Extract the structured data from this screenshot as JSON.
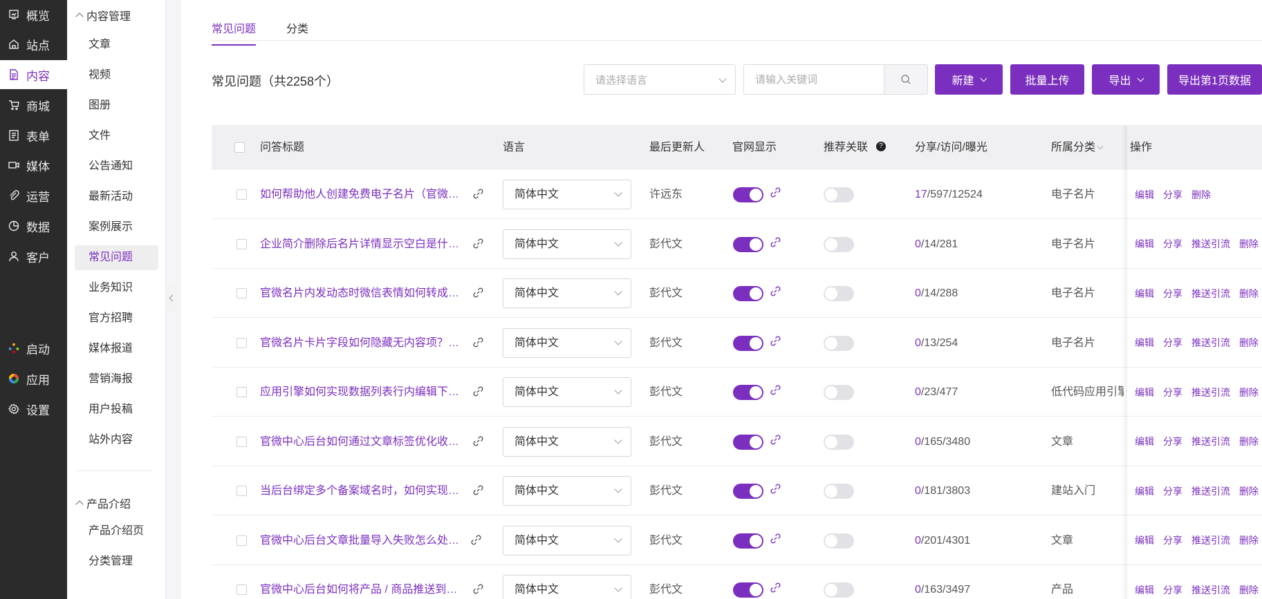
{
  "colors": {
    "accent": "#7b2fbe",
    "nav_bg": "#2b2b2b"
  },
  "nav": {
    "items": [
      {
        "label": "概览",
        "icon": "overview-icon"
      },
      {
        "label": "站点",
        "icon": "home-icon"
      },
      {
        "label": "内容",
        "icon": "document-icon",
        "active": true
      },
      {
        "label": "商城",
        "icon": "cart-icon"
      },
      {
        "label": "表单",
        "icon": "form-icon"
      },
      {
        "label": "媒体",
        "icon": "video-icon"
      },
      {
        "label": "运营",
        "icon": "paperclip-icon"
      },
      {
        "label": "数据",
        "icon": "pie-chart-icon"
      },
      {
        "label": "客户",
        "icon": "user-icon"
      }
    ],
    "bottom": [
      {
        "label": "启动",
        "icon": "launch-dots-icon"
      },
      {
        "label": "应用",
        "icon": "apps-icon"
      },
      {
        "label": "设置",
        "icon": "gear-icon"
      }
    ]
  },
  "subnav": {
    "group1": "内容管理",
    "items": [
      "文章",
      "视频",
      "图册",
      "文件",
      "公告通知",
      "最新活动",
      "案例展示",
      "常见问题",
      "业务知识",
      "官方招聘",
      "媒体报道",
      "营销海报",
      "用户投稿",
      "站外内容"
    ],
    "active_index": 7,
    "group2": "产品介绍",
    "items2": [
      "产品介绍页",
      "分类管理"
    ]
  },
  "tabs": [
    "常见问题",
    "分类"
  ],
  "list_title": "常见问题（共2258个）",
  "filters": {
    "lang_placeholder": "请选择语言",
    "keyword_placeholder": "请输入关键词"
  },
  "buttons": {
    "new": "新建",
    "batch_upload": "批量上传",
    "export": "导出",
    "export_page": "导出第1页数据"
  },
  "table": {
    "headers": [
      "问答标题",
      "语言",
      "最后更新人",
      "官网显示",
      "推荐关联",
      "分享/访问/曝光",
      "所属分类",
      "操作"
    ],
    "rows": [
      {
        "title": "如何帮助他人创建免费电子名片（官微名...",
        "lang": "简体中文",
        "updater": "许远东",
        "site_show": true,
        "recommend": false,
        "share": "17",
        "stats_rest": "/597/12524",
        "category": "电子名片",
        "ops": [
          "编辑",
          "分享",
          "删除"
        ]
      },
      {
        "title": "企业简介删除后名片详情显示空白是什么...",
        "lang": "简体中文",
        "updater": "彭代文",
        "site_show": true,
        "recommend": false,
        "share": "0",
        "stats_rest": "/14/281",
        "category": "电子名片",
        "ops": [
          "编辑",
          "分享",
          "推送引流",
          "删除"
        ]
      },
      {
        "title": "官微名片内发动态时微信表情如何转成通...",
        "lang": "简体中文",
        "updater": "彭代文",
        "site_show": true,
        "recommend": false,
        "share": "0",
        "stats_rest": "/14/288",
        "category": "电子名片",
        "ops": [
          "编辑",
          "分享",
          "推送引流",
          "删除"
        ]
      },
      {
        "title": "官微名片卡片字段如何隐藏无内容项？（...",
        "lang": "简体中文",
        "updater": "彭代文",
        "site_show": true,
        "recommend": false,
        "share": "0",
        "stats_rest": "/13/254",
        "category": "电子名片",
        "ops": [
          "编辑",
          "分享",
          "推送引流",
          "删除"
        ]
      },
      {
        "title": "应用引擎如何实现数据列表行内编辑下拉...",
        "lang": "简体中文",
        "updater": "彭代文",
        "site_show": true,
        "recommend": false,
        "share": "0",
        "stats_rest": "/23/477",
        "category": "低代码应用引擎",
        "ops": [
          "编辑",
          "分享",
          "推送引流",
          "删除"
        ]
      },
      {
        "title": "官微中心后台如何通过文章标签优化收录...",
        "lang": "简体中文",
        "updater": "彭代文",
        "site_show": true,
        "recommend": false,
        "share": "0",
        "stats_rest": "/165/3480",
        "category": "文章",
        "ops": [
          "编辑",
          "分享",
          "推送引流",
          "删除"
        ]
      },
      {
        "title": "当后台绑定多个备案域名时，如何实现不...",
        "lang": "简体中文",
        "updater": "彭代文",
        "site_show": true,
        "recommend": false,
        "share": "0",
        "stats_rest": "/181/3803",
        "category": "建站入门",
        "ops": [
          "编辑",
          "分享",
          "推送引流",
          "删除"
        ]
      },
      {
        "title": "官微中心后台文章批量导入失败怎么处理?",
        "lang": "简体中文",
        "updater": "彭代文",
        "site_show": true,
        "recommend": false,
        "share": "0",
        "stats_rest": "/201/4301",
        "category": "文章",
        "ops": [
          "编辑",
          "分享",
          "推送引流",
          "删除"
        ]
      },
      {
        "title": "官微中心后台如何将产品 / 商品推送到企...",
        "lang": "简体中文",
        "updater": "彭代文",
        "site_show": true,
        "recommend": false,
        "share": "0",
        "stats_rest": "/163/3497",
        "category": "产品",
        "ops": [
          "编辑",
          "分享",
          "推送引流",
          "删除"
        ]
      }
    ]
  }
}
